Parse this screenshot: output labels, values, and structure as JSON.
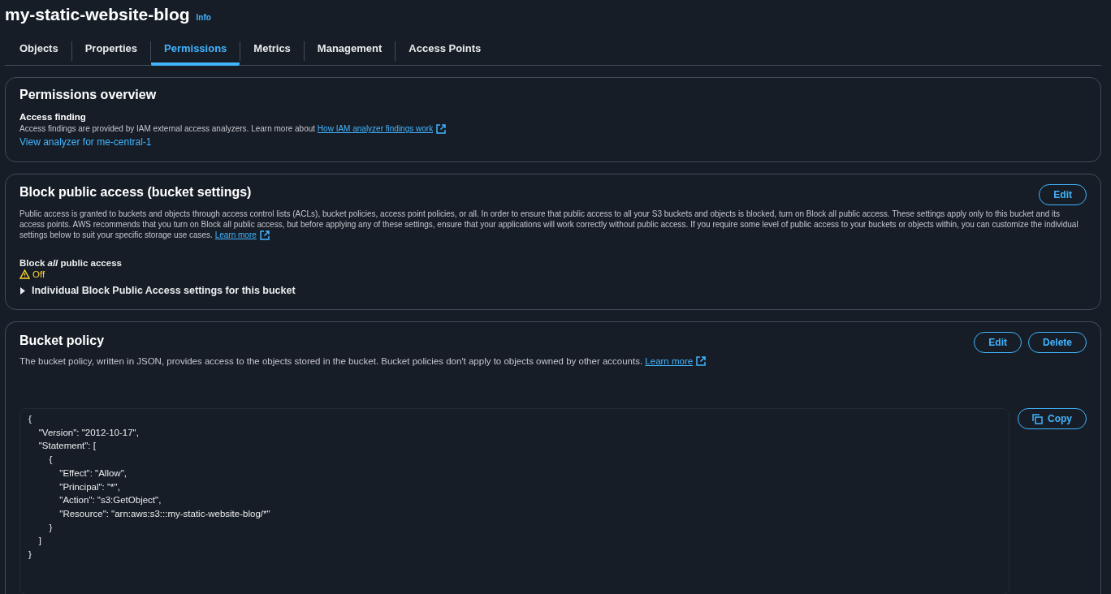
{
  "header": {
    "title": "my-static-website-blog",
    "info": "Info"
  },
  "tabs": [
    {
      "label": "Objects",
      "selected": false
    },
    {
      "label": "Properties",
      "selected": false
    },
    {
      "label": "Permissions",
      "selected": true
    },
    {
      "label": "Metrics",
      "selected": false
    },
    {
      "label": "Management",
      "selected": false
    },
    {
      "label": "Access Points",
      "selected": false
    }
  ],
  "permissions_overview": {
    "title": "Permissions overview",
    "subtitle": "Access finding",
    "text": "Access findings are provided by IAM external access analyzers. Learn more about ",
    "link": "How IAM analyzer findings work",
    "analyzer_link": "View analyzer for me-central-1"
  },
  "block_public_access": {
    "title": "Block public access (bucket settings)",
    "edit": "Edit",
    "text": "Public access is granted to buckets and objects through access control lists (ACLs), bucket policies, access point policies, or all. In order to ensure that public access to all your S3 buckets and objects is blocked, turn on Block all public access. These settings apply only to this bucket and its access points. AWS recommends that you turn on Block all public access, but before applying any of these settings, ensure that your applications will work correctly without public access. If you require some level of public access to your buckets or objects within, you can customize the individual settings below to suit your specific storage use cases. ",
    "link": "Learn more",
    "status_label": "Block *all* public access",
    "status": "Off",
    "expander": {
      "label": "Individual Block Public Access settings for this bucket",
      "expanded": false
    }
  },
  "bucket_policy": {
    "title": "Bucket policy",
    "buttons": [
      "Edit",
      "Delete"
    ],
    "text": "The bucket policy, written in JSON, provides access to the objects stored in the bucket. Bucket policies don't apply to objects owned by other accounts. ",
    "link": "Learn more",
    "copy": "Copy",
    "code": [
      "{",
      "    \"Version\": \"2012-10-17\",",
      "    \"Statement\": [",
      "        {",
      "            \"Effect\": \"Allow\",",
      "            \"Principal\": \"*\",",
      "            \"Action\": \"s3:GetObject\",",
      "            \"Resource\": \"arn:aws:s3:::my-static-website-blog/*\"",
      "        }",
      "    ]",
      "}"
    ]
  }
}
